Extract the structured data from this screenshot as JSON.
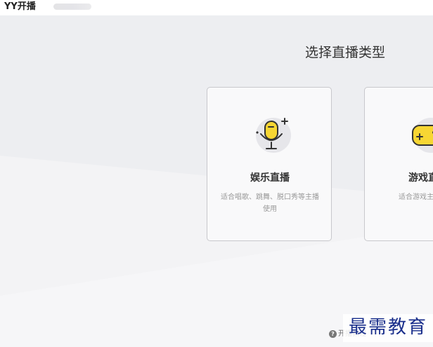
{
  "titlebar": {
    "app_name": "YY开播"
  },
  "main": {
    "title": "选择直播类型",
    "cards": [
      {
        "title": "娱乐直播",
        "description": "适合唱歌、跳舞、脱口秀等主播使用",
        "icon": "microphone-icon"
      },
      {
        "title": "游戏直",
        "description": "适合游戏主",
        "icon": "gamepad-icon"
      }
    ]
  },
  "footer": {
    "help_label": "开播教程",
    "help_icon": "question-icon"
  },
  "watermark": {
    "text": "最需教育"
  },
  "colors": {
    "accent_yellow": "#f7d633",
    "card_border": "#c8c8cc",
    "watermark_blue": "#1a2f8c"
  }
}
